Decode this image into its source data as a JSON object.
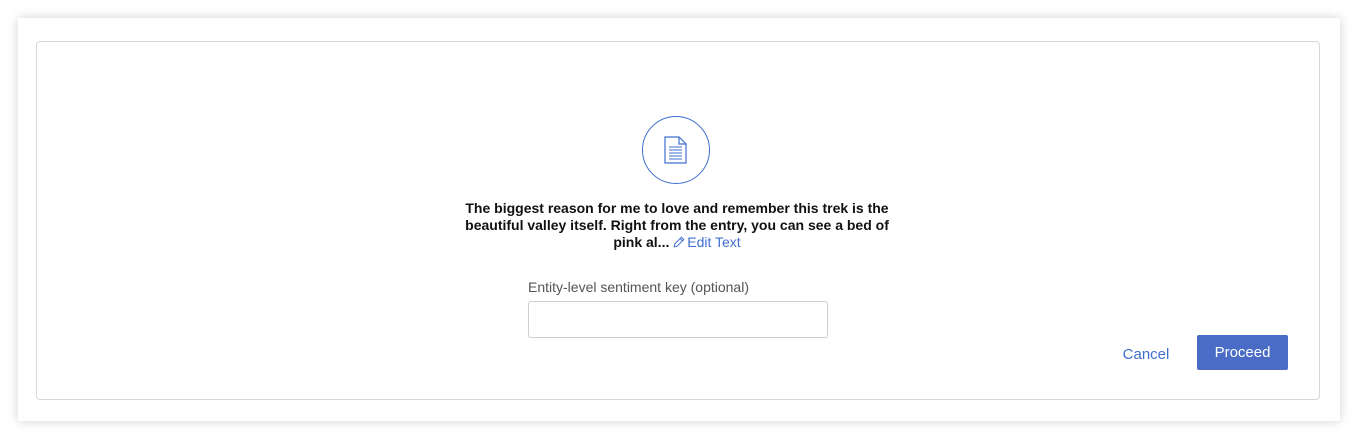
{
  "dialog": {
    "message": "The biggest reason for me to love and remember this trek is the beautiful valley itself. Right from the entry, you can see a bed of pink al...",
    "edit_text_label": "Edit Text",
    "field_label": "Entity-level sentiment key (optional)",
    "field_value": "",
    "field_placeholder": "",
    "cancel_label": "Cancel",
    "proceed_label": "Proceed",
    "icon": "document-icon",
    "edit_icon": "pencil-icon"
  },
  "colors": {
    "accent": "#3f6fcf",
    "primary_button": "#4a6cc7",
    "border": "#d8d8d8"
  }
}
